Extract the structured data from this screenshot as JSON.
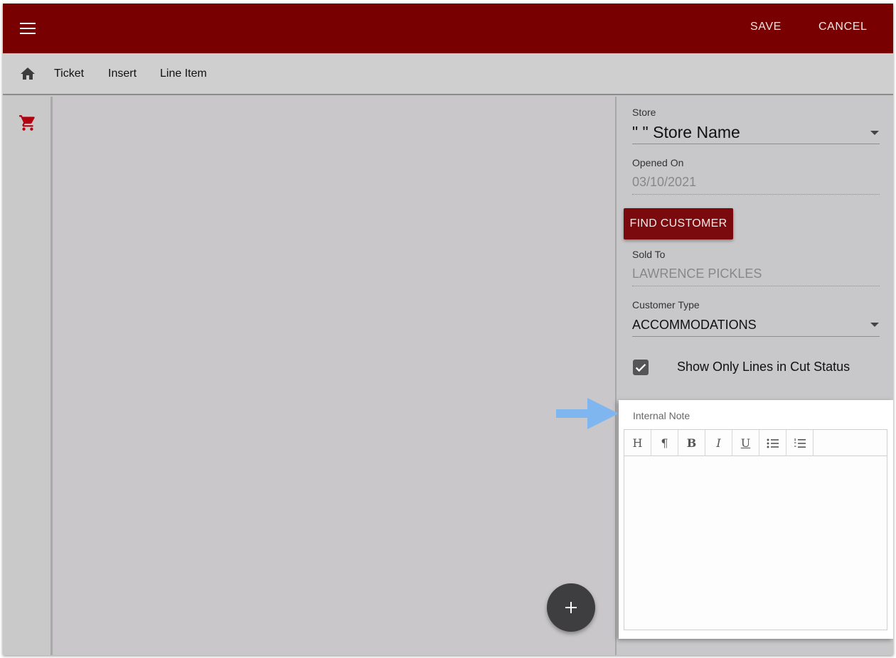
{
  "appbar": {
    "save_label": "SAVE",
    "cancel_label": "CANCEL",
    "color": "#780000"
  },
  "breadcrumb": {
    "items": [
      "Ticket",
      "Insert",
      "Line Item"
    ]
  },
  "form": {
    "store": {
      "label": "Store",
      "value": "\" \" Store Name"
    },
    "opened_on": {
      "label": "Opened On",
      "value": "03/10/2021"
    },
    "find_customer_label": "FIND CUSTOMER",
    "sold_to": {
      "label": "Sold To",
      "value": "LAWRENCE PICKLES"
    },
    "customer_type": {
      "label": "Customer Type",
      "value": "ACCOMMODATIONS"
    },
    "cut_status": {
      "label": "Show Only Lines in Cut Status",
      "checked": true
    }
  },
  "internal_note": {
    "label": "Internal Note",
    "toolbar": [
      {
        "name": "heading",
        "glyph": "H"
      },
      {
        "name": "paragraph",
        "glyph": "¶"
      },
      {
        "name": "bold",
        "glyph": "B"
      },
      {
        "name": "italic",
        "glyph": "I"
      },
      {
        "name": "underline",
        "glyph": "U"
      },
      {
        "name": "bullet-list",
        "glyph": ""
      },
      {
        "name": "numbered-list",
        "glyph": ""
      }
    ]
  },
  "icons": {
    "menu": "menu-icon",
    "home": "home-icon",
    "cart": "cart-icon",
    "fab": "plus-icon",
    "annotation": "arrow-icon"
  },
  "colors": {
    "accent": "#7a0a0e",
    "cart": "#b3000f",
    "annotation_arrow": "#7fb6f0"
  }
}
